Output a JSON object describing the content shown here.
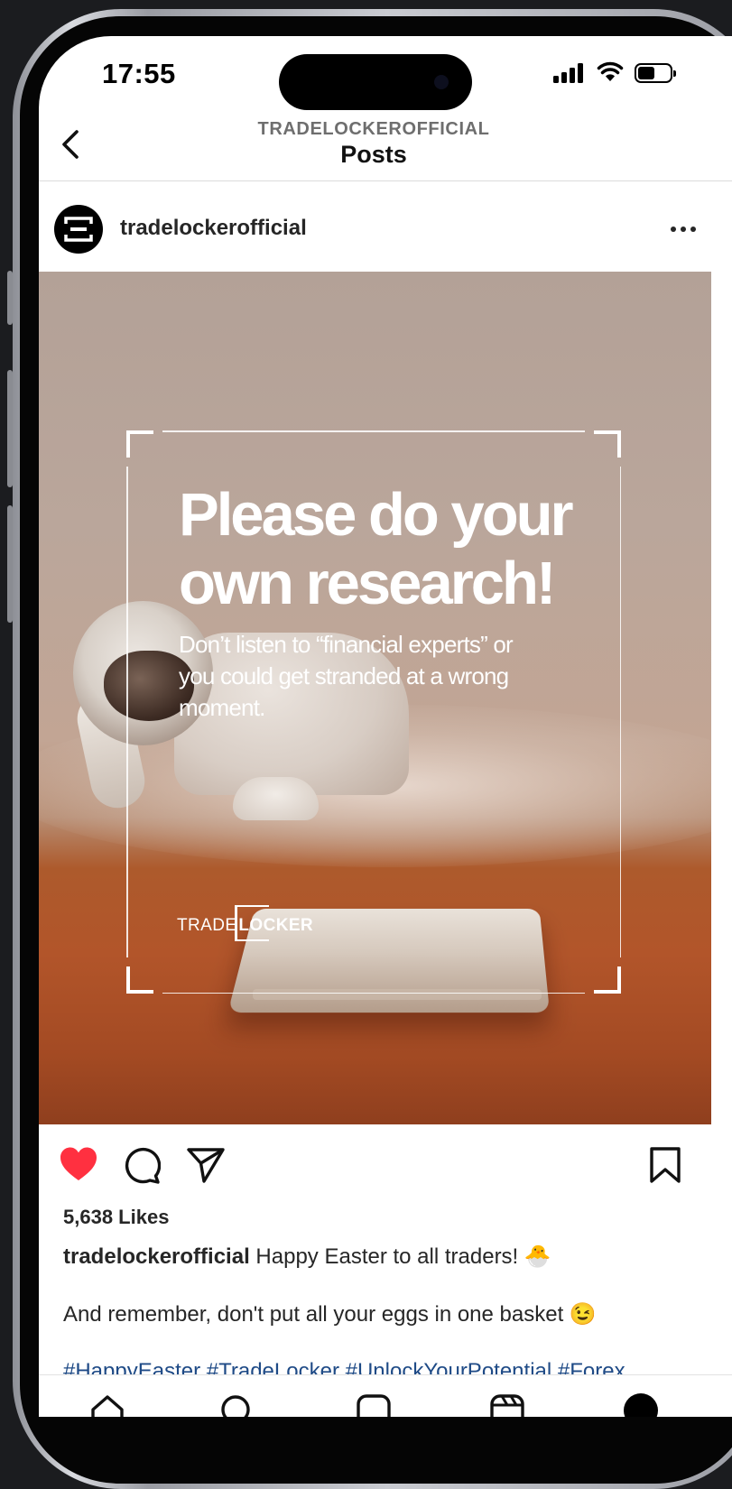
{
  "status_bar": {
    "time": "17:55"
  },
  "header": {
    "account": "TRADELOCKEROFFICIAL",
    "title": "Posts"
  },
  "post": {
    "username": "tradelockerofficial",
    "image": {
      "headline_line1": "Please do your",
      "headline_line2": "own research!",
      "sub_line1": "Don’t listen to “financial experts” or",
      "sub_line2": "you could get stranded at a wrong",
      "sub_line3": "moment.",
      "logo_light": "TRADE",
      "logo_bold": "LOCKER"
    },
    "liked": true,
    "likes": "5,638 Likes",
    "caption_user": "tradelockerofficial",
    "caption_text": "Happy Easter to all traders! 🐣",
    "caption_line2": "And remember, don't put all your eggs in one basket 😉",
    "hashtags": "#HappyEaster #TradeLocker #UnlockYourPotential #Forex"
  },
  "colors": {
    "like": "#ff3040",
    "text": "#262626",
    "hashtag": "#1e4a86"
  }
}
